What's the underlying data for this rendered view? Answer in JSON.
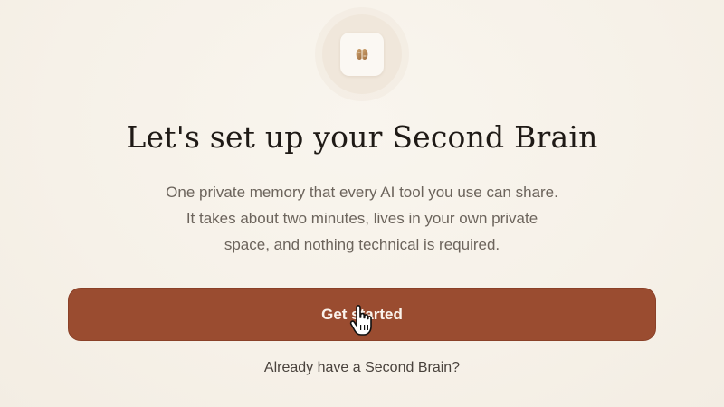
{
  "logo": {
    "icon": "brain-icon",
    "accent_color": "#b8895a"
  },
  "heading": {
    "title": "Let's set up your Second Brain"
  },
  "description": {
    "line1": "One private memory that every AI tool you use can share.",
    "line2": "It takes about two minutes, lives in your own private",
    "line3": "space, and nothing technical is required."
  },
  "actions": {
    "get_started_label": "Get started",
    "get_started_color": "#9a4c30",
    "already_have_label": "Already have a Second Brain?"
  },
  "cursor": {
    "icon": "hand-pointer-icon"
  }
}
